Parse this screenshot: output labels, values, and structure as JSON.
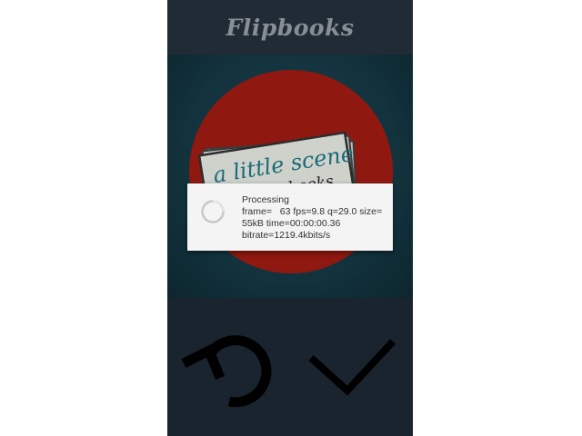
{
  "app": {
    "title": "Flipbooks"
  },
  "preview": {
    "cover_line1": "a little scene",
    "cover_line2": "flip books"
  },
  "dialog": {
    "title": "Processing",
    "line1": "frame=   63 fps=9.8 q=29.0 size=",
    "line2": "55kB time=00:00:00.36",
    "line3": "bitrate=1219.4kbits/s"
  },
  "actions": {
    "retake_icon": "rotate-ccw-icon",
    "confirm_icon": "check-icon"
  },
  "colors": {
    "app_bar": "#26323e",
    "bottom_bar": "#1e2a36",
    "preview_bg": "#163c48",
    "circle": "#a31c14",
    "accent_text": "#1d7a8a",
    "dialog_bg": "#f4f4f4"
  }
}
